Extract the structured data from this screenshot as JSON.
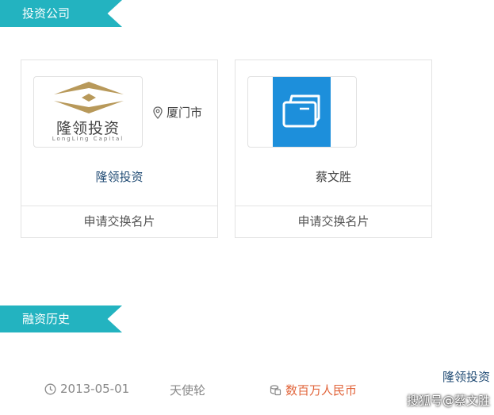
{
  "investment_section": {
    "title": "投资公司"
  },
  "cards": [
    {
      "logo_text": "隆领投资",
      "logo_subtext": "LongLing Capital",
      "location": "厦门市",
      "name": "隆领投资",
      "action_label": "申请交换名片"
    },
    {
      "name": "蔡文胜",
      "action_label": "申请交换名片"
    }
  ],
  "history_section": {
    "title": "融资历史",
    "rows": [
      {
        "date": "2013-05-01",
        "round": "天使轮",
        "amount": "数百万人民币",
        "investor": "隆领投资"
      }
    ]
  },
  "watermark": "搜狐号@蔡文胜",
  "colors": {
    "accent": "#23b3c0",
    "link": "#1f4a73",
    "amount": "#e1643a",
    "logo_gold": "#b8995a",
    "logo_blue": "#1d8fdb"
  }
}
